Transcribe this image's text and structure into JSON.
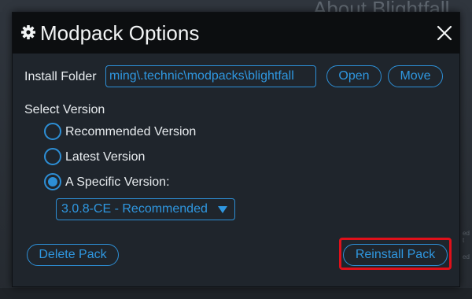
{
  "background": {
    "title": "About Blightfall",
    "edge_text_1": "ed t",
    "edge_text_2": "ed"
  },
  "dialog": {
    "title": "Modpack Options",
    "title_icon": "gear-icon",
    "close_icon": "close-icon"
  },
  "install": {
    "label": "Install Folder",
    "value": "ming\\.technic\\modpacks\\blightfall",
    "open_label": "Open",
    "move_label": "Move"
  },
  "version": {
    "section_label": "Select Version",
    "options": [
      {
        "label": "Recommended Version",
        "checked": false
      },
      {
        "label": "Latest Version",
        "checked": false
      },
      {
        "label": "A Specific Version:",
        "checked": true
      }
    ],
    "selected": "3.0.8-CE - Recommended"
  },
  "actions": {
    "delete_label": "Delete Pack",
    "reinstall_label": "Reinstall Pack"
  },
  "colors": {
    "accent": "#2d8fd6",
    "highlight": "#e0101a",
    "titlebar": "#0c0e10",
    "dialog_bg": "#1f252c"
  }
}
